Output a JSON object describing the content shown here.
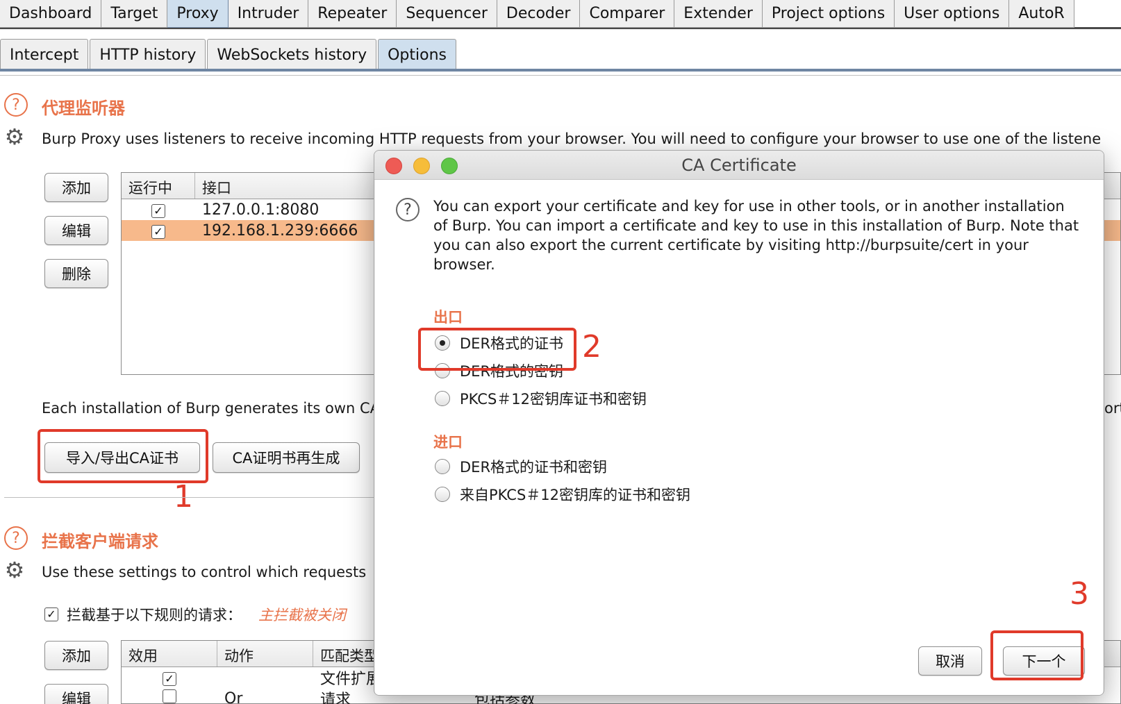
{
  "top_tabs": [
    "Dashboard",
    "Target",
    "Proxy",
    "Intruder",
    "Repeater",
    "Sequencer",
    "Decoder",
    "Comparer",
    "Extender",
    "Project options",
    "User options",
    "AutoR"
  ],
  "sub_tabs": [
    "Intercept",
    "HTTP history",
    "WebSockets history",
    "Options"
  ],
  "listeners": {
    "title": "代理监听器",
    "description": "Burp Proxy uses listeners to receive incoming HTTP requests from your browser. You will need to configure your browser to use one of the listene",
    "buttons": {
      "add": "添加",
      "edit": "编辑",
      "remove": "删除"
    },
    "columns": [
      "运行中",
      "接口"
    ],
    "rows": [
      {
        "running": "✓",
        "interface": "127.0.0.1:8080"
      },
      {
        "running": "✓",
        "interface": "192.168.1.239:6666"
      }
    ],
    "ca_note": "Each installation of Burp generates its own CA",
    "ca_note_tail": "ort",
    "import_export_button": "导入/导出CA证书",
    "regenerate_button": "CA证明书再生成"
  },
  "intercept": {
    "title": "拦截客户端请求",
    "description": "Use these settings to control which requests",
    "checkbox_label": "拦截基于以下规则的请求：",
    "checkbox_checked": "✓",
    "status": "主拦截被关闭",
    "buttons": {
      "add": "添加",
      "edit": "编辑"
    },
    "columns": [
      "效用",
      "动作",
      "匹配类型"
    ],
    "rows": [
      {
        "enabled": "✓",
        "operator": "",
        "type": "文件扩展"
      },
      {
        "enabled": "",
        "operator": "Or",
        "type": "请求",
        "extra": "包括参数"
      }
    ]
  },
  "dialog": {
    "title": "CA Certificate",
    "text": "You can export your certificate and key for use in other tools, or in another installation of Burp. You can import a certificate and key to use in this installation of Burp. Note that you can also export the current certificate by visiting http://burpsuite/cert in your browser.",
    "export_label": "出口",
    "export_options": [
      "DER格式的证书",
      "DER格式的密钥",
      "PKCS＃12密钥库证书和密钥"
    ],
    "import_label": "进口",
    "import_options": [
      "DER格式的证书和密钥",
      "来自PKCS＃12密钥库的证书和密钥"
    ],
    "cancel_button": "取消",
    "next_button": "下一个"
  },
  "annotations": {
    "one": "1",
    "two": "2",
    "three": "3"
  },
  "colors": {
    "accent_orange": "#e8734a",
    "annotation_red": "#e03a2a",
    "selected_row": "#f7b98b",
    "active_tab": "#cfdfee"
  }
}
